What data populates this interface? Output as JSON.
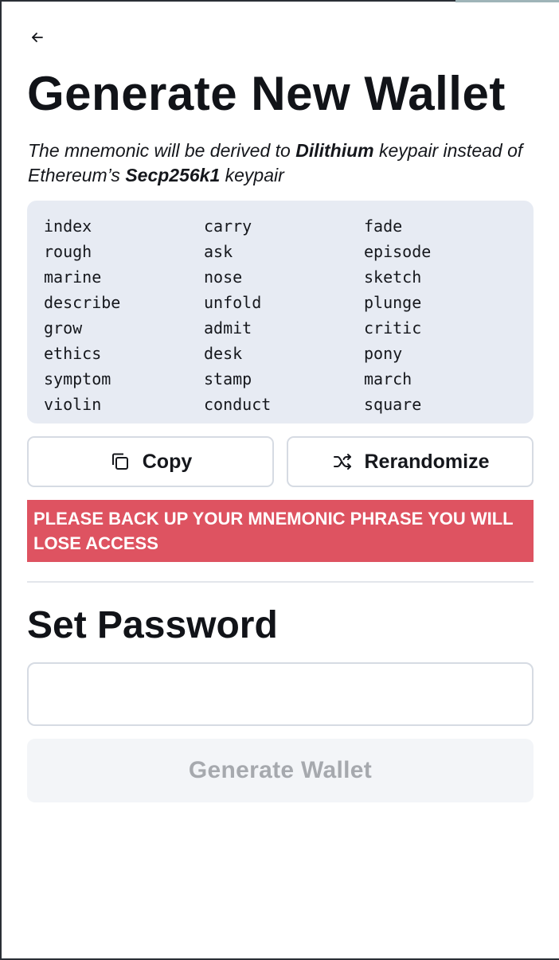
{
  "header": {
    "title": "Generate New Wallet",
    "subtitle_parts": [
      "The mnemonic will be derived to ",
      "Dilithium",
      " keypair instead of Ethereum’s ",
      "Secp256k1",
      " keypair"
    ]
  },
  "mnemonic": {
    "words": [
      "index",
      "carry",
      "fade",
      "rough",
      "ask",
      "episode",
      "marine",
      "nose",
      "sketch",
      "describe",
      "unfold",
      "plunge",
      "grow",
      "admit",
      "critic",
      "ethics",
      "desk",
      "pony",
      "symptom",
      "stamp",
      "march",
      "violin",
      "conduct",
      "square"
    ]
  },
  "actions": {
    "copy_label": "Copy",
    "rerandomize_label": "Rerandomize"
  },
  "warning": "PLEASE BACK UP YOUR MNEMONIC PHRASE YOU WILL LOSE ACCESS",
  "password": {
    "title": "Set Password",
    "value": "",
    "placeholder": ""
  },
  "submit": {
    "label": "Generate Wallet",
    "disabled": true
  },
  "icons": {
    "back": "arrow-left-icon",
    "copy": "copy-icon",
    "rerandomize": "shuffle-icon"
  },
  "colors": {
    "warning_bg": "#de5361",
    "mnemonic_bg": "#e7ebf3",
    "disabled_text": "#a6a9ae"
  }
}
